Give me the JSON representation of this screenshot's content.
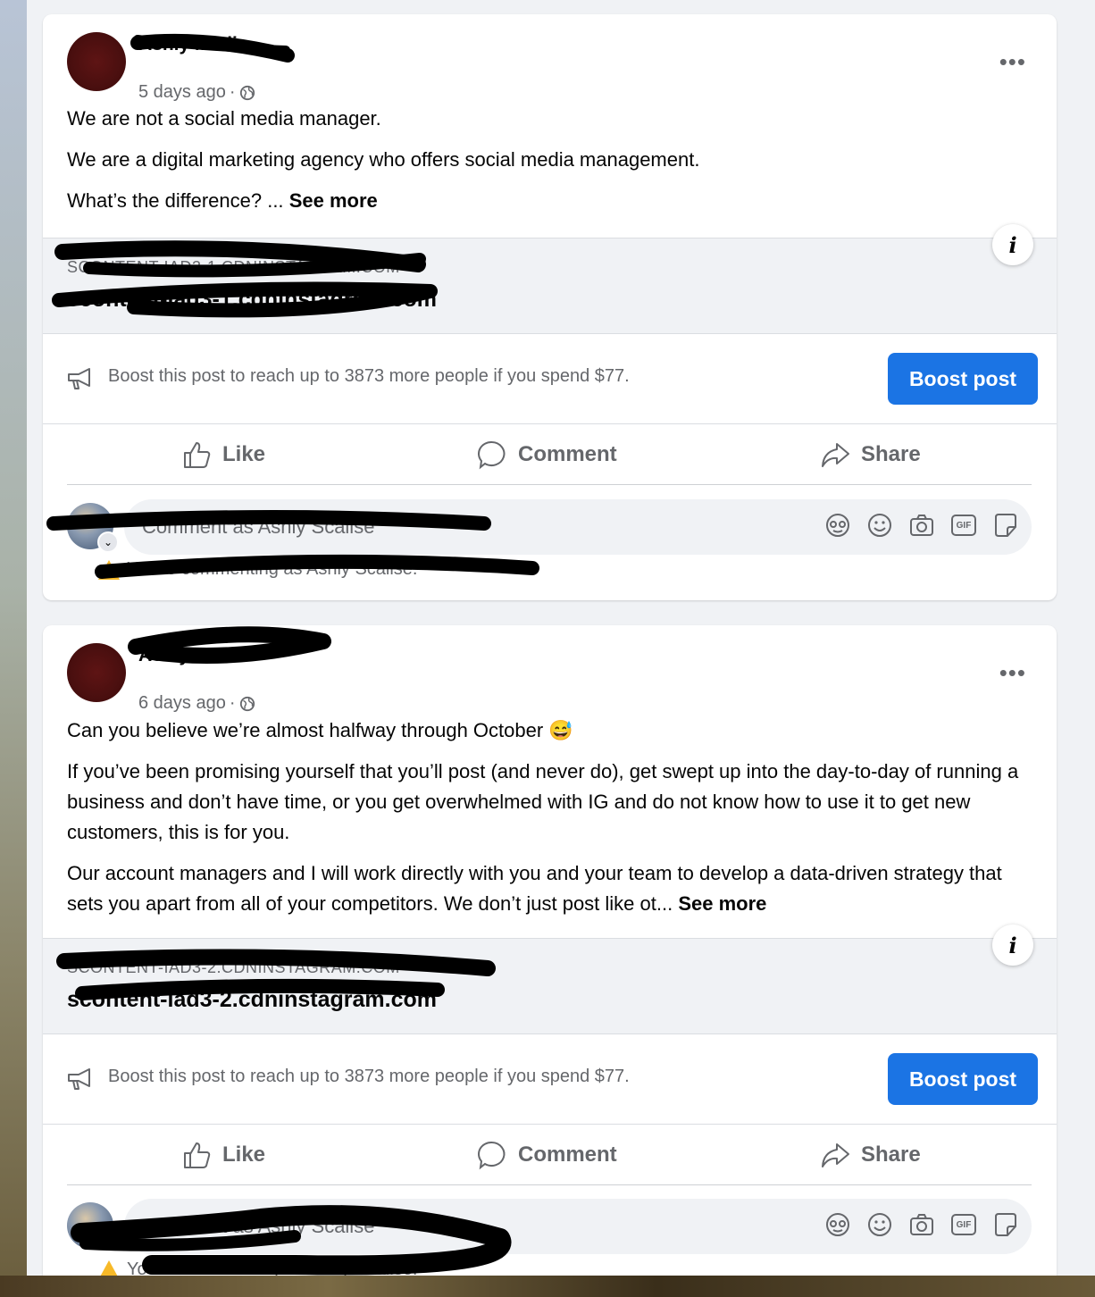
{
  "posts": [
    {
      "page_name": "Ashly Media",
      "timestamp": "5 days ago",
      "separator": "·",
      "paragraphs": [
        "We are not a social media manager.",
        "We are a digital marketing agency who offers social media management.",
        "What’s the difference? ..."
      ],
      "see_more": "See more",
      "link_domain": "SCONTENT-IAD3-1.CDNINSTAGRAM.COM",
      "link_title": "scontent-iad3-1.cdninstagram.com",
      "boost_text": "Boost this post to reach up to 3873 more people if you spend $77.",
      "boost_button": "Boost post",
      "actions": {
        "like": "Like",
        "comment": "Comment",
        "share": "Share"
      },
      "comment_placeholder": "Comment as Ashly Scalise",
      "commenting_as": "You're commenting as Ashly Scalise."
    },
    {
      "page_name": "Ashly Media",
      "timestamp": "6 days ago",
      "separator": "·",
      "paragraphs": [
        "Can you believe we’re almost halfway through October 😅",
        "If you’ve been promising yourself that you’ll post (and never do), get swept up into the day-to-day of running a business and don’t have time, or you get overwhelmed with IG and do not know how to use it to get new customers, this is for you.",
        "Our account managers and I will work directly with you and your team to develop a data-driven strategy that sets you apart from all of your competitors. We don’t just post like ot..."
      ],
      "see_more": "See more",
      "link_domain": "SCONTENT-IAD3-2.CDNINSTAGRAM.COM",
      "link_title": "scontent-iad3-2.cdninstagram.com",
      "boost_text": "Boost this post to reach up to 3873 more people if you spend $77.",
      "boost_button": "Boost post",
      "actions": {
        "like": "Like",
        "comment": "Comment",
        "share": "Share"
      },
      "comment_placeholder": "Comment as Ashly Scalise",
      "commenting_as": "You're commenting as Ashly Scalise."
    }
  ],
  "icons": {
    "more": "more-options-icon",
    "globe": "globe-icon",
    "info": "info-icon",
    "megaphone": "megaphone-icon",
    "like": "thumbs-up-icon",
    "comment": "comment-bubble-icon",
    "share": "share-arrow-icon",
    "avatar_sticker": "avatar-sticker-icon",
    "emoji": "emoji-icon",
    "camera": "camera-icon",
    "gif": "gif-icon",
    "sticker": "sticker-icon",
    "warning": "warning-icon"
  },
  "colors": {
    "accent": "#1b74e4",
    "text_primary": "#050505",
    "text_secondary": "#65676b",
    "page_background": "#f0f2f5"
  }
}
